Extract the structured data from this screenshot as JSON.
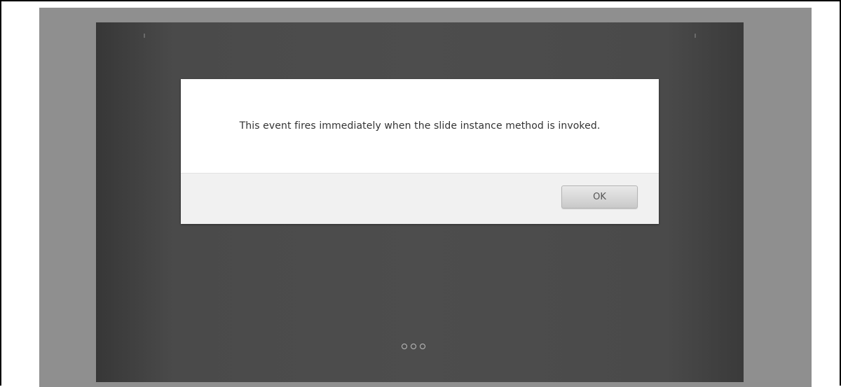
{
  "modal": {
    "message": "This event fires immediately when the slide instance method is invoked.",
    "ok_label": "OK"
  },
  "carousel": {
    "indicator_count": 3
  },
  "colors": {
    "overlay": "#8f8f8f",
    "carousel_bg": "#4d4d4d",
    "modal_footer": "#f1f1f1"
  }
}
